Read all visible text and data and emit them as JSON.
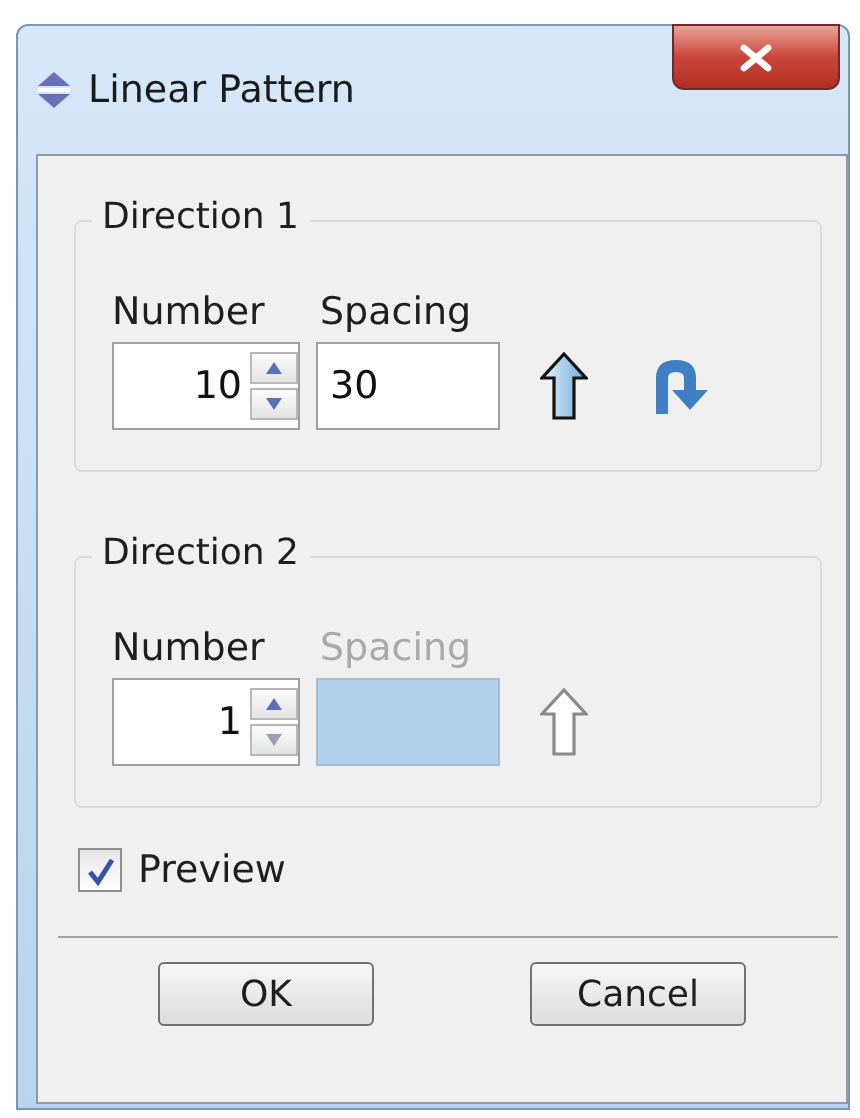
{
  "window": {
    "title": "Linear Pattern"
  },
  "directions": [
    {
      "title": "Direction 1",
      "number_label": "Number",
      "spacing_label": "Spacing",
      "number": "10",
      "spacing": "30",
      "disabled": false
    },
    {
      "title": "Direction 2",
      "number_label": "Number",
      "spacing_label": "Spacing",
      "number": "1",
      "disabled": true
    }
  ],
  "preview": {
    "label": "Preview",
    "checked": true
  },
  "buttons": [
    "OK",
    "Cancel"
  ]
}
